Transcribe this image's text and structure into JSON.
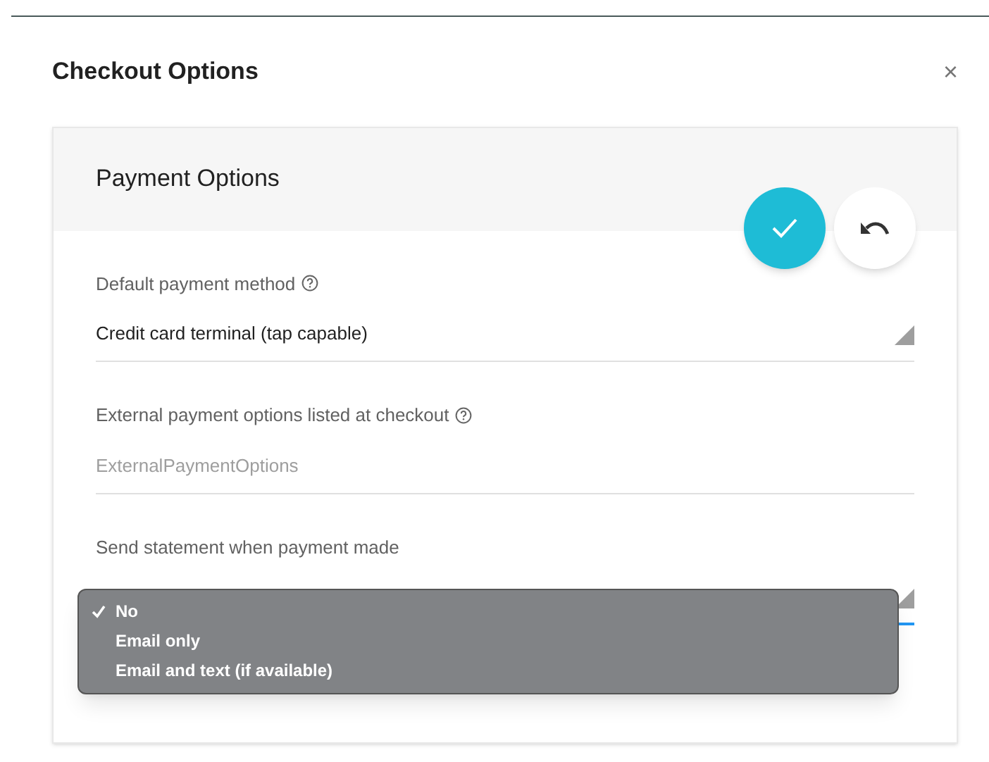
{
  "dialog": {
    "title": "Checkout Options",
    "close": "×"
  },
  "card": {
    "title": "Payment Options"
  },
  "fields": [
    {
      "kind": "select",
      "label": "Default payment method",
      "help": true,
      "value": "Credit card terminal (tap capable)",
      "focused": false
    },
    {
      "kind": "text",
      "label": "External payment options listed at checkout",
      "help": true,
      "placeholder": "ExternalPaymentOptions",
      "focused": false
    },
    {
      "kind": "select",
      "label": "Send statement when payment made",
      "help": false,
      "focused": true,
      "options": [
        {
          "label": "No",
          "selected": true
        },
        {
          "label": "Email only",
          "selected": false
        },
        {
          "label": "Email and text (if available)",
          "selected": false
        }
      ]
    }
  ]
}
